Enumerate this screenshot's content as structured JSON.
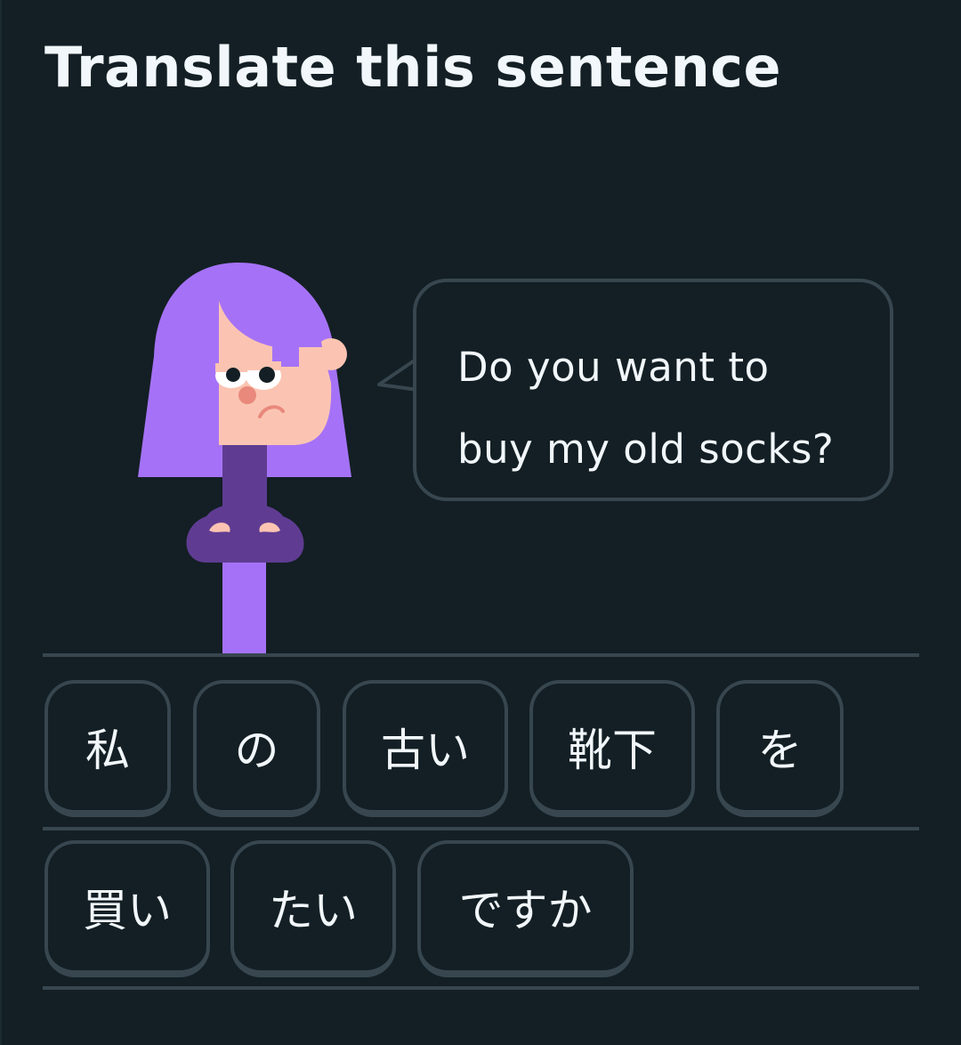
{
  "prompt": {
    "title": "Translate this sentence"
  },
  "speech": {
    "line1": "Do you want to",
    "line2": "buy my old socks?"
  },
  "word_bank": {
    "row1": [
      "私",
      "の",
      "古い",
      "靴下",
      "を"
    ],
    "row2": [
      "買い",
      "たい",
      "ですか"
    ]
  },
  "colors": {
    "background": "#131f24",
    "border": "#37464f",
    "text": "#f1f7fb",
    "hair": "#a572f7",
    "skin": "#fbc4b2",
    "shirt": "#5f3c92"
  }
}
